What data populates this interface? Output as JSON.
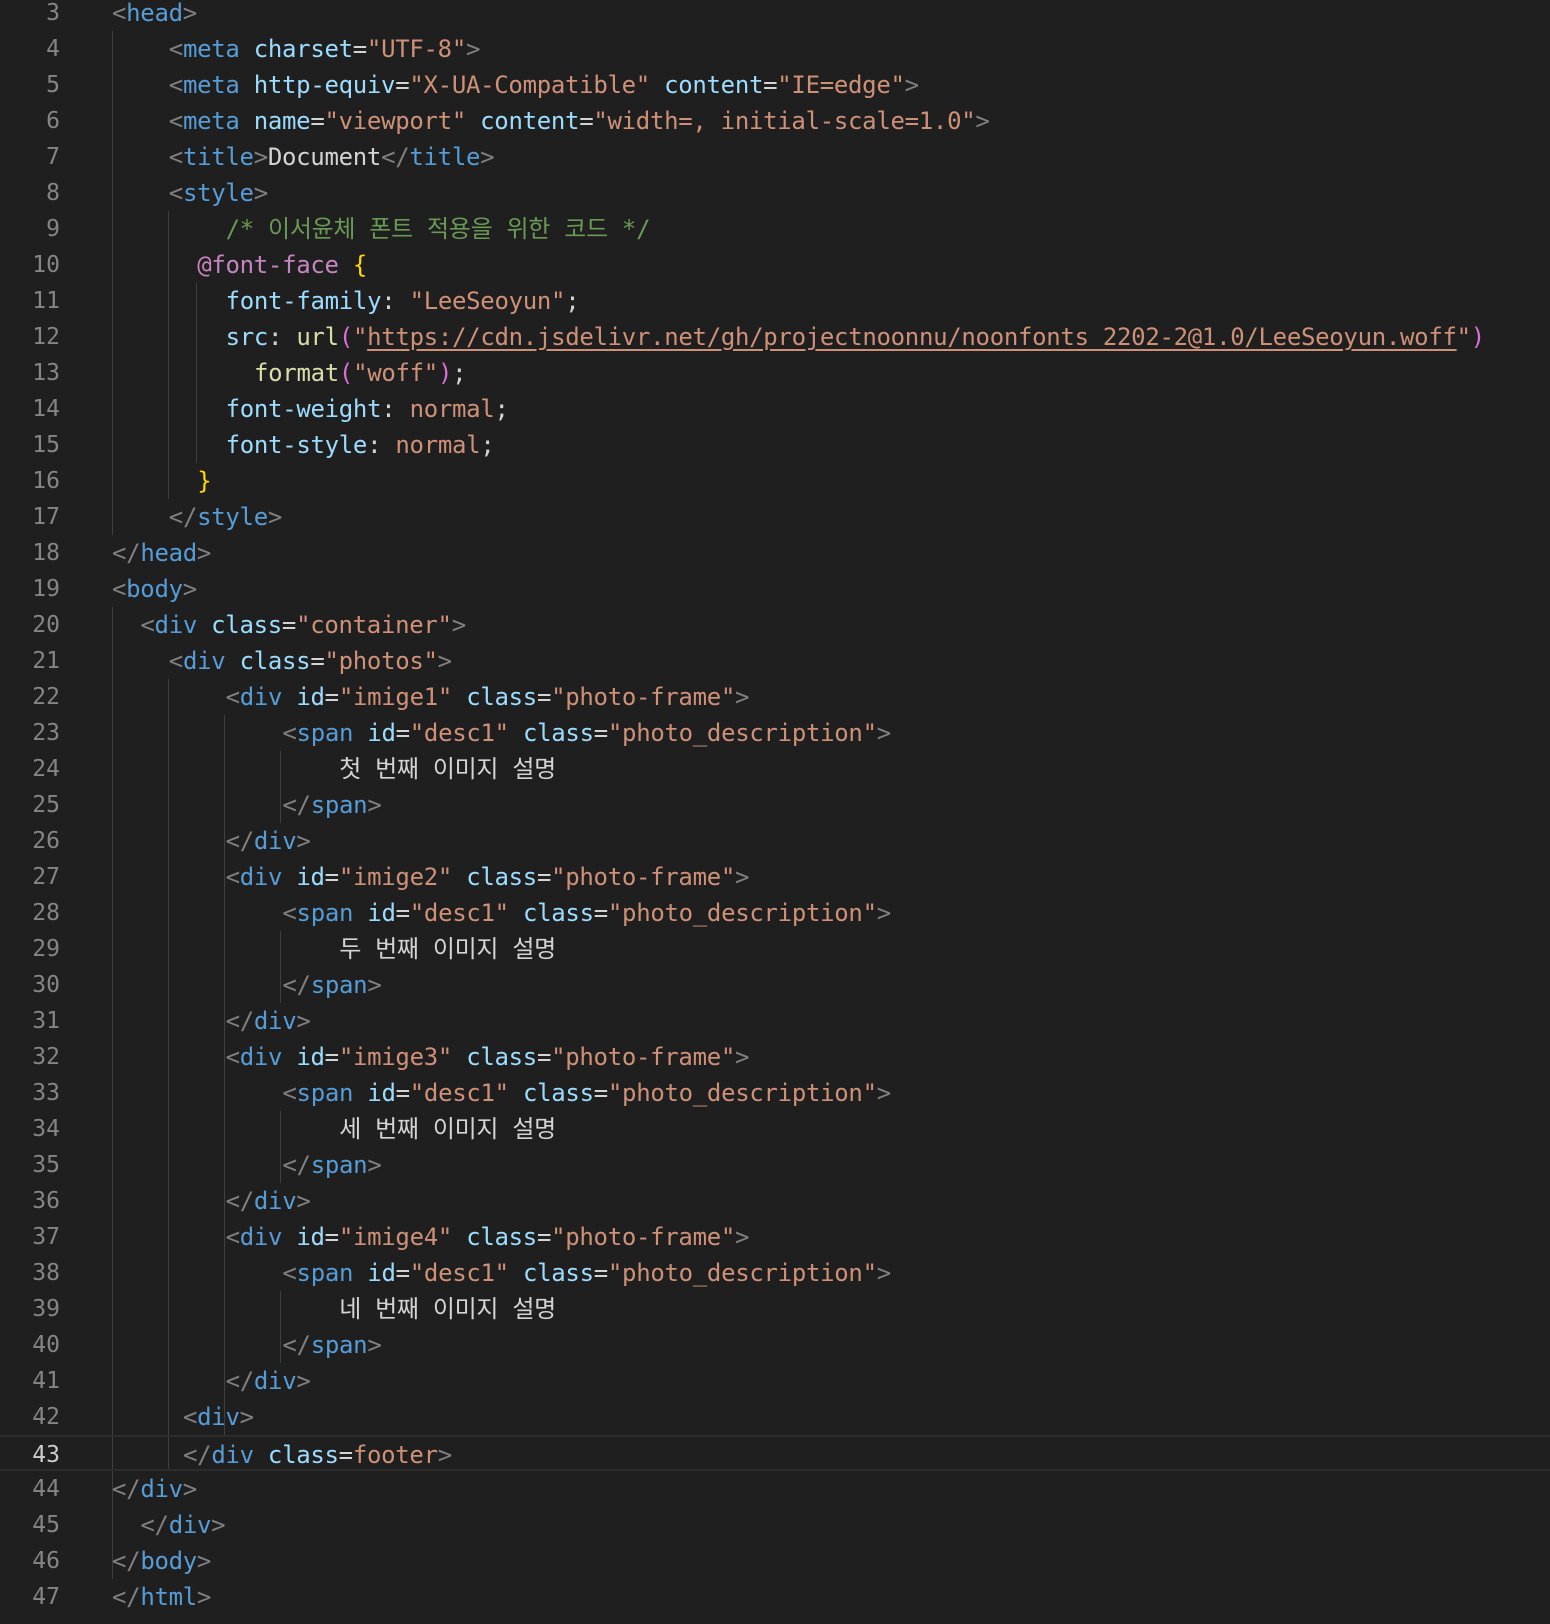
{
  "editor": {
    "language": "html",
    "current_line": 43,
    "lines": [
      {
        "n": "3",
        "indent": 0,
        "tokens": [
          [
            "b",
            "<"
          ],
          [
            "t",
            "head"
          ],
          [
            "b",
            ">"
          ]
        ]
      },
      {
        "n": "4",
        "indent": 2,
        "tokens": [
          [
            "b",
            "<"
          ],
          [
            "t",
            "meta"
          ],
          [
            "w",
            " "
          ],
          [
            "a",
            "charset"
          ],
          [
            "w",
            "="
          ],
          [
            "s",
            "\"UTF-8\""
          ],
          [
            "b",
            ">"
          ]
        ]
      },
      {
        "n": "5",
        "indent": 2,
        "tokens": [
          [
            "b",
            "<"
          ],
          [
            "t",
            "meta"
          ],
          [
            "w",
            " "
          ],
          [
            "a",
            "http-equiv"
          ],
          [
            "w",
            "="
          ],
          [
            "s",
            "\"X-UA-Compatible\""
          ],
          [
            "w",
            " "
          ],
          [
            "a",
            "content"
          ],
          [
            "w",
            "="
          ],
          [
            "s",
            "\"IE=edge\""
          ],
          [
            "b",
            ">"
          ]
        ]
      },
      {
        "n": "6",
        "indent": 2,
        "tokens": [
          [
            "b",
            "<"
          ],
          [
            "t",
            "meta"
          ],
          [
            "w",
            " "
          ],
          [
            "a",
            "name"
          ],
          [
            "w",
            "="
          ],
          [
            "s",
            "\"viewport\""
          ],
          [
            "w",
            " "
          ],
          [
            "a",
            "content"
          ],
          [
            "w",
            "="
          ],
          [
            "s",
            "\"width=, initial-scale=1.0\""
          ],
          [
            "b",
            ">"
          ]
        ]
      },
      {
        "n": "7",
        "indent": 2,
        "tokens": [
          [
            "b",
            "<"
          ],
          [
            "t",
            "title"
          ],
          [
            "b",
            ">"
          ],
          [
            "w",
            "Document"
          ],
          [
            "b",
            "</"
          ],
          [
            "t",
            "title"
          ],
          [
            "b",
            ">"
          ]
        ]
      },
      {
        "n": "8",
        "indent": 2,
        "tokens": [
          [
            "b",
            "<"
          ],
          [
            "t",
            "style"
          ],
          [
            "b",
            ">"
          ]
        ]
      },
      {
        "n": "9",
        "indent": 4,
        "tokens": [
          [
            "c",
            "/* 이서윤체 폰트 적용을 위한 코드 */"
          ]
        ]
      },
      {
        "n": "10",
        "indent": 3,
        "tokens": [
          [
            "at",
            "@font-face"
          ],
          [
            "w",
            " "
          ],
          [
            "y",
            "{"
          ]
        ]
      },
      {
        "n": "11",
        "indent": 4,
        "tokens": [
          [
            "a",
            "font-family"
          ],
          [
            "w",
            ": "
          ],
          [
            "s",
            "\"LeeSeoyun\""
          ],
          [
            "w",
            ";"
          ]
        ]
      },
      {
        "n": "12",
        "indent": 4,
        "tokens": [
          [
            "a",
            "src"
          ],
          [
            "w",
            ": "
          ],
          [
            "f",
            "url"
          ],
          [
            "p",
            "("
          ],
          [
            "s",
            "\""
          ],
          [
            "u",
            "https://cdn.jsdelivr.net/gh/projectnoonnu/noonfonts_2202-2@1.0/LeeSeoyun.woff"
          ],
          [
            "s",
            "\""
          ],
          [
            "p",
            ")"
          ]
        ]
      },
      {
        "n": "13",
        "indent": 5,
        "tokens": [
          [
            "f",
            "format"
          ],
          [
            "p",
            "("
          ],
          [
            "s",
            "\"woff\""
          ],
          [
            "p",
            ")"
          ],
          [
            "w",
            ";"
          ]
        ]
      },
      {
        "n": "14",
        "indent": 4,
        "tokens": [
          [
            "a",
            "font-weight"
          ],
          [
            "w",
            ": "
          ],
          [
            "s",
            "normal"
          ],
          [
            "w",
            ";"
          ]
        ]
      },
      {
        "n": "15",
        "indent": 4,
        "tokens": [
          [
            "a",
            "font-style"
          ],
          [
            "w",
            ": "
          ],
          [
            "s",
            "normal"
          ],
          [
            "w",
            ";"
          ]
        ]
      },
      {
        "n": "16",
        "indent": 3,
        "tokens": [
          [
            "y",
            "}"
          ]
        ]
      },
      {
        "n": "17",
        "indent": 2,
        "tokens": [
          [
            "b",
            "</"
          ],
          [
            "t",
            "style"
          ],
          [
            "b",
            ">"
          ]
        ]
      },
      {
        "n": "18",
        "indent": 0,
        "tokens": [
          [
            "b",
            "</"
          ],
          [
            "t",
            "head"
          ],
          [
            "b",
            ">"
          ]
        ]
      },
      {
        "n": "19",
        "indent": 0,
        "tokens": [
          [
            "b",
            "<"
          ],
          [
            "t",
            "body"
          ],
          [
            "b",
            ">"
          ]
        ]
      },
      {
        "n": "20",
        "indent": 1,
        "tokens": [
          [
            "b",
            "<"
          ],
          [
            "t",
            "div"
          ],
          [
            "w",
            " "
          ],
          [
            "a",
            "class"
          ],
          [
            "w",
            "="
          ],
          [
            "s",
            "\"container\""
          ],
          [
            "b",
            ">"
          ]
        ]
      },
      {
        "n": "21",
        "indent": 2,
        "tokens": [
          [
            "b",
            "<"
          ],
          [
            "t",
            "div"
          ],
          [
            "w",
            " "
          ],
          [
            "a",
            "class"
          ],
          [
            "w",
            "="
          ],
          [
            "s",
            "\"photos\""
          ],
          [
            "b",
            ">"
          ]
        ]
      },
      {
        "n": "22",
        "indent": 4,
        "tokens": [
          [
            "b",
            "<"
          ],
          [
            "t",
            "div"
          ],
          [
            "w",
            " "
          ],
          [
            "a",
            "id"
          ],
          [
            "w",
            "="
          ],
          [
            "s",
            "\"imige1\""
          ],
          [
            "w",
            " "
          ],
          [
            "a",
            "class"
          ],
          [
            "w",
            "="
          ],
          [
            "s",
            "\"photo-frame\""
          ],
          [
            "b",
            ">"
          ]
        ]
      },
      {
        "n": "23",
        "indent": 6,
        "tokens": [
          [
            "b",
            "<"
          ],
          [
            "t",
            "span"
          ],
          [
            "w",
            " "
          ],
          [
            "a",
            "id"
          ],
          [
            "w",
            "="
          ],
          [
            "s",
            "\"desc1\""
          ],
          [
            "w",
            " "
          ],
          [
            "a",
            "class"
          ],
          [
            "w",
            "="
          ],
          [
            "s",
            "\"photo_description\""
          ],
          [
            "b",
            ">"
          ]
        ]
      },
      {
        "n": "24",
        "indent": 8,
        "tokens": [
          [
            "w",
            "첫 번째 이미지 설명"
          ]
        ]
      },
      {
        "n": "25",
        "indent": 6,
        "tokens": [
          [
            "b",
            "</"
          ],
          [
            "t",
            "span"
          ],
          [
            "b",
            ">"
          ]
        ]
      },
      {
        "n": "26",
        "indent": 4,
        "tokens": [
          [
            "b",
            "</"
          ],
          [
            "t",
            "div"
          ],
          [
            "b",
            ">"
          ]
        ]
      },
      {
        "n": "27",
        "indent": 4,
        "tokens": [
          [
            "b",
            "<"
          ],
          [
            "t",
            "div"
          ],
          [
            "w",
            " "
          ],
          [
            "a",
            "id"
          ],
          [
            "w",
            "="
          ],
          [
            "s",
            "\"imige2\""
          ],
          [
            "w",
            " "
          ],
          [
            "a",
            "class"
          ],
          [
            "w",
            "="
          ],
          [
            "s",
            "\"photo-frame\""
          ],
          [
            "b",
            ">"
          ]
        ]
      },
      {
        "n": "28",
        "indent": 6,
        "tokens": [
          [
            "b",
            "<"
          ],
          [
            "t",
            "span"
          ],
          [
            "w",
            " "
          ],
          [
            "a",
            "id"
          ],
          [
            "w",
            "="
          ],
          [
            "s",
            "\"desc1\""
          ],
          [
            "w",
            " "
          ],
          [
            "a",
            "class"
          ],
          [
            "w",
            "="
          ],
          [
            "s",
            "\"photo_description\""
          ],
          [
            "b",
            ">"
          ]
        ]
      },
      {
        "n": "29",
        "indent": 8,
        "tokens": [
          [
            "w",
            "두 번째 이미지 설명"
          ]
        ]
      },
      {
        "n": "30",
        "indent": 6,
        "tokens": [
          [
            "b",
            "</"
          ],
          [
            "t",
            "span"
          ],
          [
            "b",
            ">"
          ]
        ]
      },
      {
        "n": "31",
        "indent": 4,
        "tokens": [
          [
            "b",
            "</"
          ],
          [
            "t",
            "div"
          ],
          [
            "b",
            ">"
          ]
        ]
      },
      {
        "n": "32",
        "indent": 4,
        "tokens": [
          [
            "b",
            "<"
          ],
          [
            "t",
            "div"
          ],
          [
            "w",
            " "
          ],
          [
            "a",
            "id"
          ],
          [
            "w",
            "="
          ],
          [
            "s",
            "\"imige3\""
          ],
          [
            "w",
            " "
          ],
          [
            "a",
            "class"
          ],
          [
            "w",
            "="
          ],
          [
            "s",
            "\"photo-frame\""
          ],
          [
            "b",
            ">"
          ]
        ]
      },
      {
        "n": "33",
        "indent": 6,
        "tokens": [
          [
            "b",
            "<"
          ],
          [
            "t",
            "span"
          ],
          [
            "w",
            " "
          ],
          [
            "a",
            "id"
          ],
          [
            "w",
            "="
          ],
          [
            "s",
            "\"desc1\""
          ],
          [
            "w",
            " "
          ],
          [
            "a",
            "class"
          ],
          [
            "w",
            "="
          ],
          [
            "s",
            "\"photo_description\""
          ],
          [
            "b",
            ">"
          ]
        ]
      },
      {
        "n": "34",
        "indent": 8,
        "tokens": [
          [
            "w",
            "세 번째 이미지 설명"
          ]
        ]
      },
      {
        "n": "35",
        "indent": 6,
        "tokens": [
          [
            "b",
            "</"
          ],
          [
            "t",
            "span"
          ],
          [
            "b",
            ">"
          ]
        ]
      },
      {
        "n": "36",
        "indent": 4,
        "tokens": [
          [
            "b",
            "</"
          ],
          [
            "t",
            "div"
          ],
          [
            "b",
            ">"
          ]
        ]
      },
      {
        "n": "37",
        "indent": 4,
        "tokens": [
          [
            "b",
            "<"
          ],
          [
            "t",
            "div"
          ],
          [
            "w",
            " "
          ],
          [
            "a",
            "id"
          ],
          [
            "w",
            "="
          ],
          [
            "s",
            "\"imige4\""
          ],
          [
            "w",
            " "
          ],
          [
            "a",
            "class"
          ],
          [
            "w",
            "="
          ],
          [
            "s",
            "\"photo-frame\""
          ],
          [
            "b",
            ">"
          ]
        ]
      },
      {
        "n": "38",
        "indent": 6,
        "tokens": [
          [
            "b",
            "<"
          ],
          [
            "t",
            "span"
          ],
          [
            "w",
            " "
          ],
          [
            "a",
            "id"
          ],
          [
            "w",
            "="
          ],
          [
            "s",
            "\"desc1\""
          ],
          [
            "w",
            " "
          ],
          [
            "a",
            "class"
          ],
          [
            "w",
            "="
          ],
          [
            "s",
            "\"photo_description\""
          ],
          [
            "b",
            ">"
          ]
        ]
      },
      {
        "n": "39",
        "indent": 8,
        "tokens": [
          [
            "w",
            "네 번째 이미지 설명"
          ]
        ]
      },
      {
        "n": "40",
        "indent": 6,
        "tokens": [
          [
            "b",
            "</"
          ],
          [
            "t",
            "span"
          ],
          [
            "b",
            ">"
          ]
        ]
      },
      {
        "n": "41",
        "indent": 4,
        "tokens": [
          [
            "b",
            "</"
          ],
          [
            "t",
            "div"
          ],
          [
            "b",
            ">"
          ]
        ]
      },
      {
        "n": "42",
        "indent": 2.5,
        "tokens": [
          [
            "b",
            "<"
          ],
          [
            "t",
            "div"
          ],
          [
            "b",
            ">"
          ]
        ]
      },
      {
        "n": "43",
        "indent": 2.5,
        "tokens": [
          [
            "b",
            "</"
          ],
          [
            "t",
            "div"
          ],
          [
            "w",
            " "
          ],
          [
            "a",
            "class"
          ],
          [
            "w",
            "="
          ],
          [
            "s",
            "footer"
          ],
          [
            "b",
            ">"
          ]
        ]
      },
      {
        "n": "44",
        "indent": 0,
        "tokens": [
          [
            "b",
            "</"
          ],
          [
            "t",
            "div"
          ],
          [
            "b",
            ">"
          ]
        ]
      },
      {
        "n": "45",
        "indent": 1,
        "tokens": [
          [
            "b",
            "</"
          ],
          [
            "t",
            "div"
          ],
          [
            "b",
            ">"
          ]
        ]
      },
      {
        "n": "46",
        "indent": 0,
        "tokens": [
          [
            "b",
            "</"
          ],
          [
            "t",
            "body"
          ],
          [
            "b",
            ">"
          ]
        ]
      },
      {
        "n": "47",
        "indent": 0,
        "tokens": [
          [
            "b",
            "</"
          ],
          [
            "t",
            "html"
          ],
          [
            "b",
            ">"
          ]
        ]
      }
    ]
  }
}
